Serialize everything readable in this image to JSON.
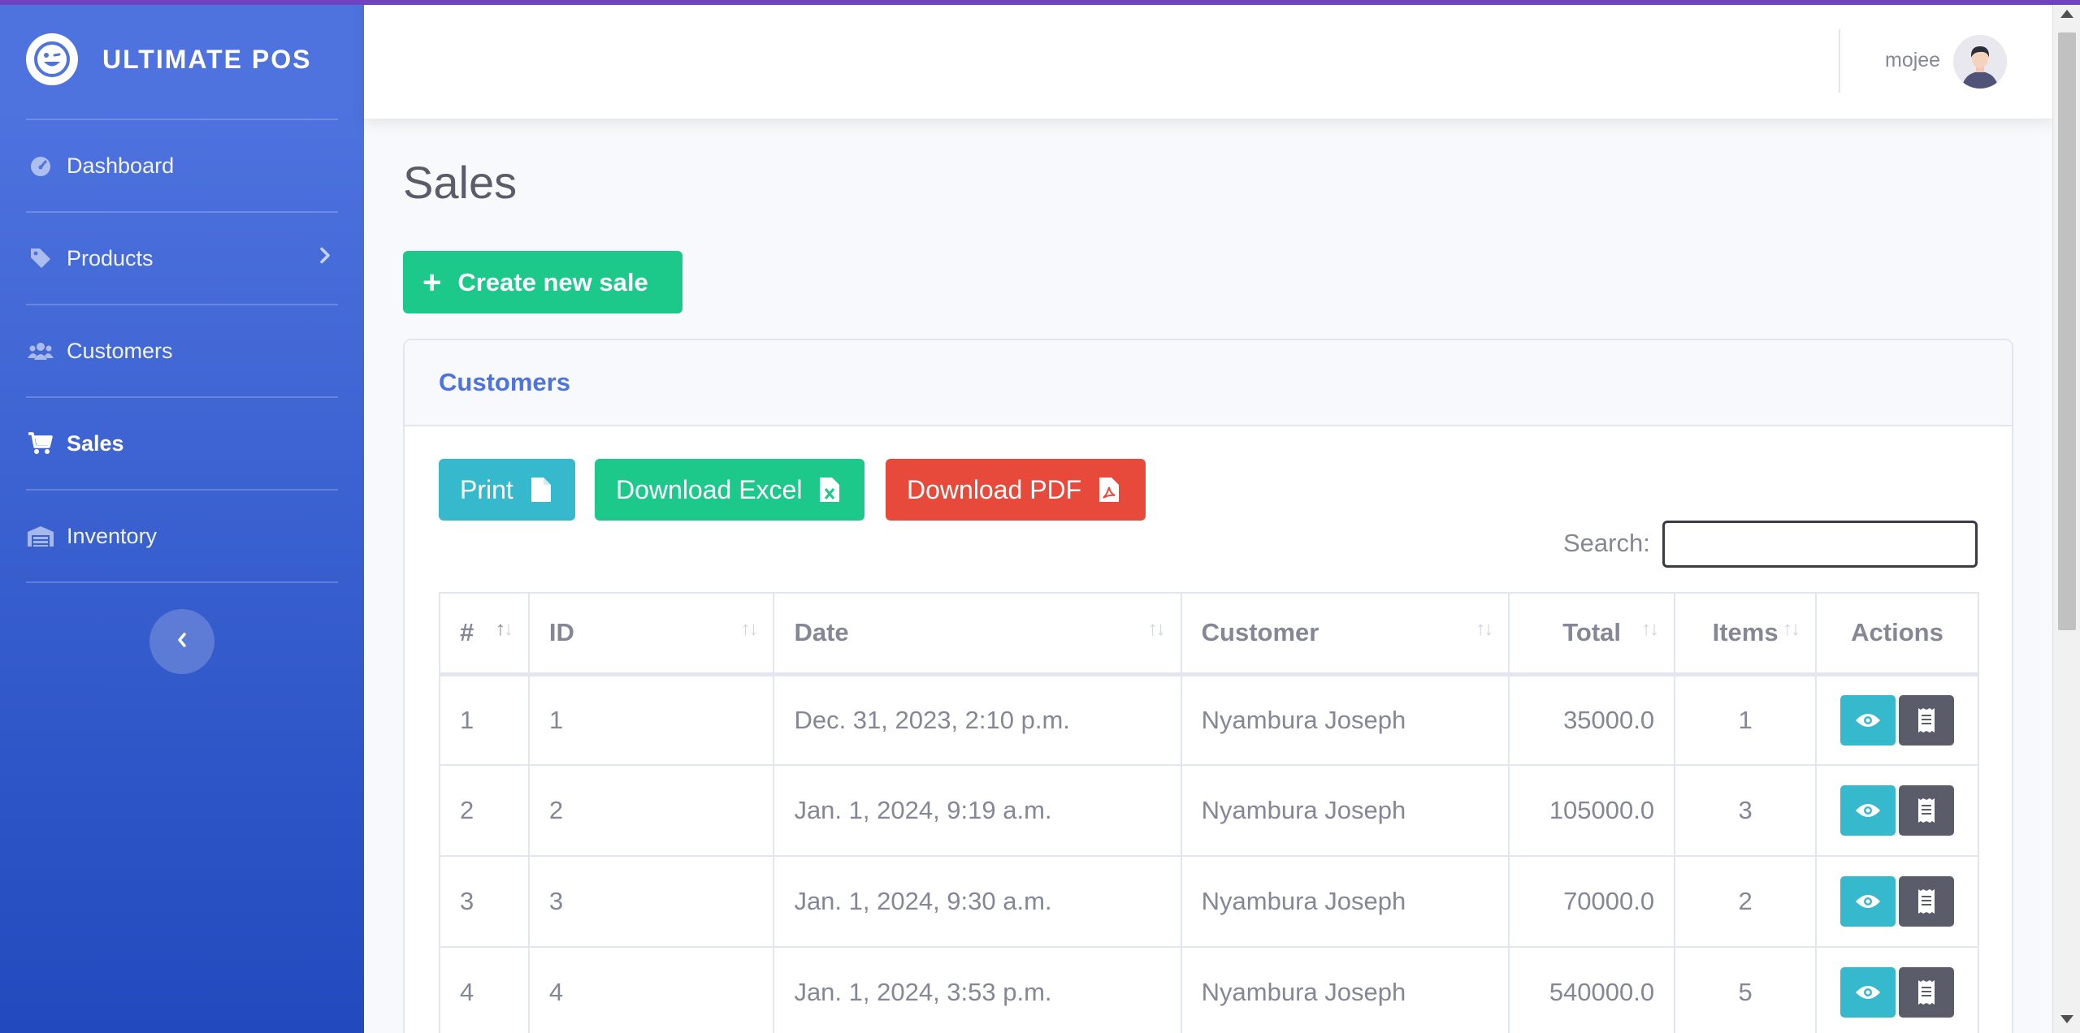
{
  "brand": {
    "name": "ULTIMATE POS",
    "logo_icon": "wink-face-icon"
  },
  "sidebar": {
    "items": [
      {
        "label": "Dashboard",
        "icon": "tachometer-icon",
        "active": false
      },
      {
        "label": "Products",
        "icon": "tag-icon",
        "active": false,
        "has_submenu": true
      },
      {
        "label": "Customers",
        "icon": "users-icon",
        "active": false
      },
      {
        "label": "Sales",
        "icon": "cart-icon",
        "active": true
      },
      {
        "label": "Inventory",
        "icon": "warehouse-icon",
        "active": false
      }
    ]
  },
  "topbar": {
    "username": "mojee"
  },
  "page": {
    "title": "Sales",
    "create_label": "Create new sale"
  },
  "card": {
    "header": "Customers",
    "buttons": {
      "print": "Print",
      "excel": "Download Excel",
      "pdf": "Download PDF"
    },
    "search_label": "Search:",
    "search_value": ""
  },
  "table": {
    "columns": [
      "#",
      "ID",
      "Date",
      "Customer",
      "Total",
      "Items",
      "Actions"
    ],
    "rows": [
      {
        "n": "1",
        "id": "1",
        "date": "Dec. 31, 2023, 2:10 p.m.",
        "customer": "Nyambura Joseph",
        "total": "35000.0",
        "items": "1"
      },
      {
        "n": "2",
        "id": "2",
        "date": "Jan. 1, 2024, 9:19 a.m.",
        "customer": "Nyambura Joseph",
        "total": "105000.0",
        "items": "3"
      },
      {
        "n": "3",
        "id": "3",
        "date": "Jan. 1, 2024, 9:30 a.m.",
        "customer": "Nyambura Joseph",
        "total": "70000.0",
        "items": "2"
      },
      {
        "n": "4",
        "id": "4",
        "date": "Jan. 1, 2024, 3:53 p.m.",
        "customer": "Nyambura Joseph",
        "total": "540000.0",
        "items": "5"
      }
    ]
  },
  "colors": {
    "primary": "#4e73df",
    "success": "#1cc88a",
    "info": "#36b9cc",
    "danger": "#e74a3b",
    "dark": "#5a5c69",
    "accent_bar": "#6f42c1"
  }
}
